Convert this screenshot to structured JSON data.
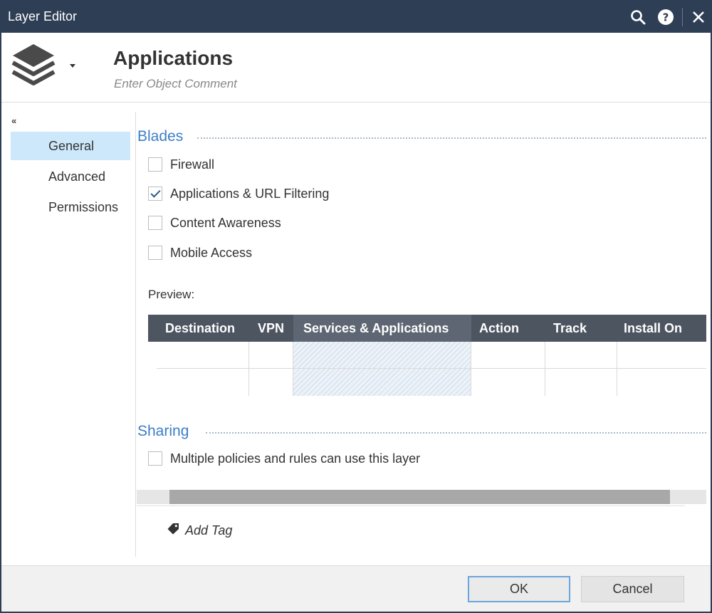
{
  "window": {
    "title": "Layer Editor"
  },
  "header": {
    "object_name": "Applications",
    "comment_placeholder": "Enter Object Comment"
  },
  "sidebar": {
    "collapse_glyph": "«",
    "items": [
      {
        "label": "General",
        "active": true
      },
      {
        "label": "Advanced",
        "active": false
      },
      {
        "label": "Permissions",
        "active": false
      }
    ]
  },
  "blades": {
    "title": "Blades",
    "options": [
      {
        "label": "Firewall",
        "checked": false
      },
      {
        "label": "Applications & URL Filtering",
        "checked": true
      },
      {
        "label": "Content Awareness",
        "checked": false
      },
      {
        "label": "Mobile Access",
        "checked": false
      }
    ]
  },
  "preview": {
    "label": "Preview:",
    "columns": [
      "Destination",
      "VPN",
      "Services & Applications",
      "Action",
      "Track",
      "Install On"
    ],
    "highlighted_column": "Services & Applications"
  },
  "sharing": {
    "title": "Sharing",
    "option": {
      "label": "Multiple policies and rules can use this layer",
      "checked": false
    }
  },
  "tags": {
    "add_label": "Add Tag"
  },
  "footer": {
    "ok_label": "OK",
    "cancel_label": "Cancel"
  },
  "icons": {
    "search": "search-icon",
    "help": "help-icon",
    "close": "close-icon",
    "layers": "layers-icon",
    "tag": "tag-icon"
  },
  "colors": {
    "titlebar": "#2e3e55",
    "accent": "#3d7ec8",
    "nav_active": "#cde8fb",
    "table_header": "#4d5561"
  }
}
